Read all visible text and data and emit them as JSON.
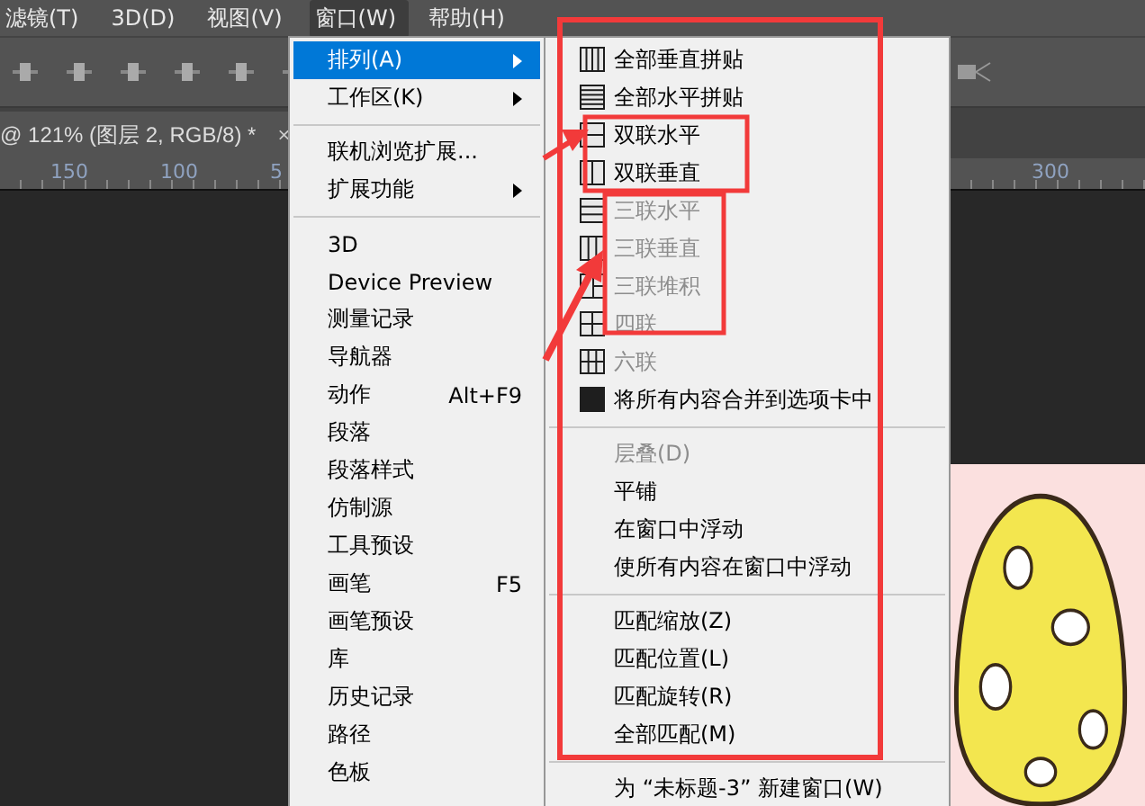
{
  "menubar": [
    {
      "label": "滤镜(T)",
      "selected": false
    },
    {
      "label": "3D(D)",
      "selected": false
    },
    {
      "label": "视图(V)",
      "selected": false
    },
    {
      "label": "窗口(W)",
      "selected": true
    },
    {
      "label": "帮助(H)",
      "selected": false
    }
  ],
  "document_tab": {
    "title": "@ 121% (图层 2, RGB/8) *",
    "close": "×"
  },
  "ruler": {
    "labels": [
      "150",
      "100",
      "5",
      "300"
    ]
  },
  "window_menu": {
    "items": [
      {
        "kind": "item",
        "label": "排列(A)",
        "submenu": true,
        "selected": true
      },
      {
        "kind": "item",
        "label": "工作区(K)",
        "submenu": true,
        "selected": false
      },
      {
        "kind": "separator"
      },
      {
        "kind": "item",
        "label": "联机浏览扩展...",
        "submenu": false,
        "selected": false
      },
      {
        "kind": "item",
        "label": "扩展功能",
        "submenu": true,
        "selected": false
      },
      {
        "kind": "separator"
      },
      {
        "kind": "item",
        "label": "3D",
        "submenu": false,
        "selected": false
      },
      {
        "kind": "item",
        "label": "Device Preview",
        "submenu": false,
        "selected": false
      },
      {
        "kind": "item",
        "label": "测量记录",
        "submenu": false,
        "selected": false
      },
      {
        "kind": "item",
        "label": "导航器",
        "submenu": false,
        "selected": false
      },
      {
        "kind": "item",
        "label": "动作",
        "shortcut": "Alt+F9",
        "submenu": false,
        "selected": false
      },
      {
        "kind": "item",
        "label": "段落",
        "submenu": false,
        "selected": false
      },
      {
        "kind": "item",
        "label": "段落样式",
        "submenu": false,
        "selected": false
      },
      {
        "kind": "item",
        "label": "仿制源",
        "submenu": false,
        "selected": false
      },
      {
        "kind": "item",
        "label": "工具预设",
        "submenu": false,
        "selected": false
      },
      {
        "kind": "item",
        "label": "画笔",
        "shortcut": "F5",
        "submenu": false,
        "selected": false
      },
      {
        "kind": "item",
        "label": "画笔预设",
        "submenu": false,
        "selected": false
      },
      {
        "kind": "item",
        "label": "库",
        "submenu": false,
        "selected": false
      },
      {
        "kind": "item",
        "label": "历史记录",
        "submenu": false,
        "selected": false
      },
      {
        "kind": "item",
        "label": "路径",
        "submenu": false,
        "selected": false
      },
      {
        "kind": "item",
        "label": "色板",
        "submenu": false,
        "selected": false
      }
    ]
  },
  "arrange_submenu": {
    "items": [
      {
        "kind": "cols4",
        "label": "全部垂直拼贴",
        "disabled": false
      },
      {
        "kind": "rows5",
        "label": "全部水平拼贴",
        "disabled": false
      },
      {
        "kind": "rows2",
        "label": "双联水平",
        "disabled": false
      },
      {
        "kind": "cols2",
        "label": "双联垂直",
        "disabled": false
      },
      {
        "kind": "rows3",
        "label": "三联水平",
        "disabled": true
      },
      {
        "kind": "cols3",
        "label": "三联垂直",
        "disabled": true
      },
      {
        "kind": "stack3",
        "label": "三联堆积",
        "disabled": true
      },
      {
        "kind": "grid4",
        "label": "四联",
        "disabled": true
      },
      {
        "kind": "grid6",
        "label": "六联",
        "disabled": true
      },
      {
        "kind": "single",
        "label": "将所有内容合并到选项卡中",
        "disabled": false
      },
      {
        "kind": "separator"
      },
      {
        "kind": "plain",
        "label": "层叠(D)",
        "disabled": true
      },
      {
        "kind": "plain",
        "label": "平铺",
        "disabled": false
      },
      {
        "kind": "plain",
        "label": "在窗口中浮动",
        "disabled": false
      },
      {
        "kind": "plain",
        "label": "使所有内容在窗口中浮动",
        "disabled": false
      },
      {
        "kind": "separator"
      },
      {
        "kind": "plain",
        "label": "匹配缩放(Z)",
        "disabled": false
      },
      {
        "kind": "plain",
        "label": "匹配位置(L)",
        "disabled": false
      },
      {
        "kind": "plain",
        "label": "匹配旋转(R)",
        "disabled": false
      },
      {
        "kind": "plain",
        "label": "全部匹配(M)",
        "disabled": false
      },
      {
        "kind": "separator"
      },
      {
        "kind": "plain",
        "label": "为 “未标题-3” 新建窗口(W)",
        "disabled": false
      }
    ]
  }
}
